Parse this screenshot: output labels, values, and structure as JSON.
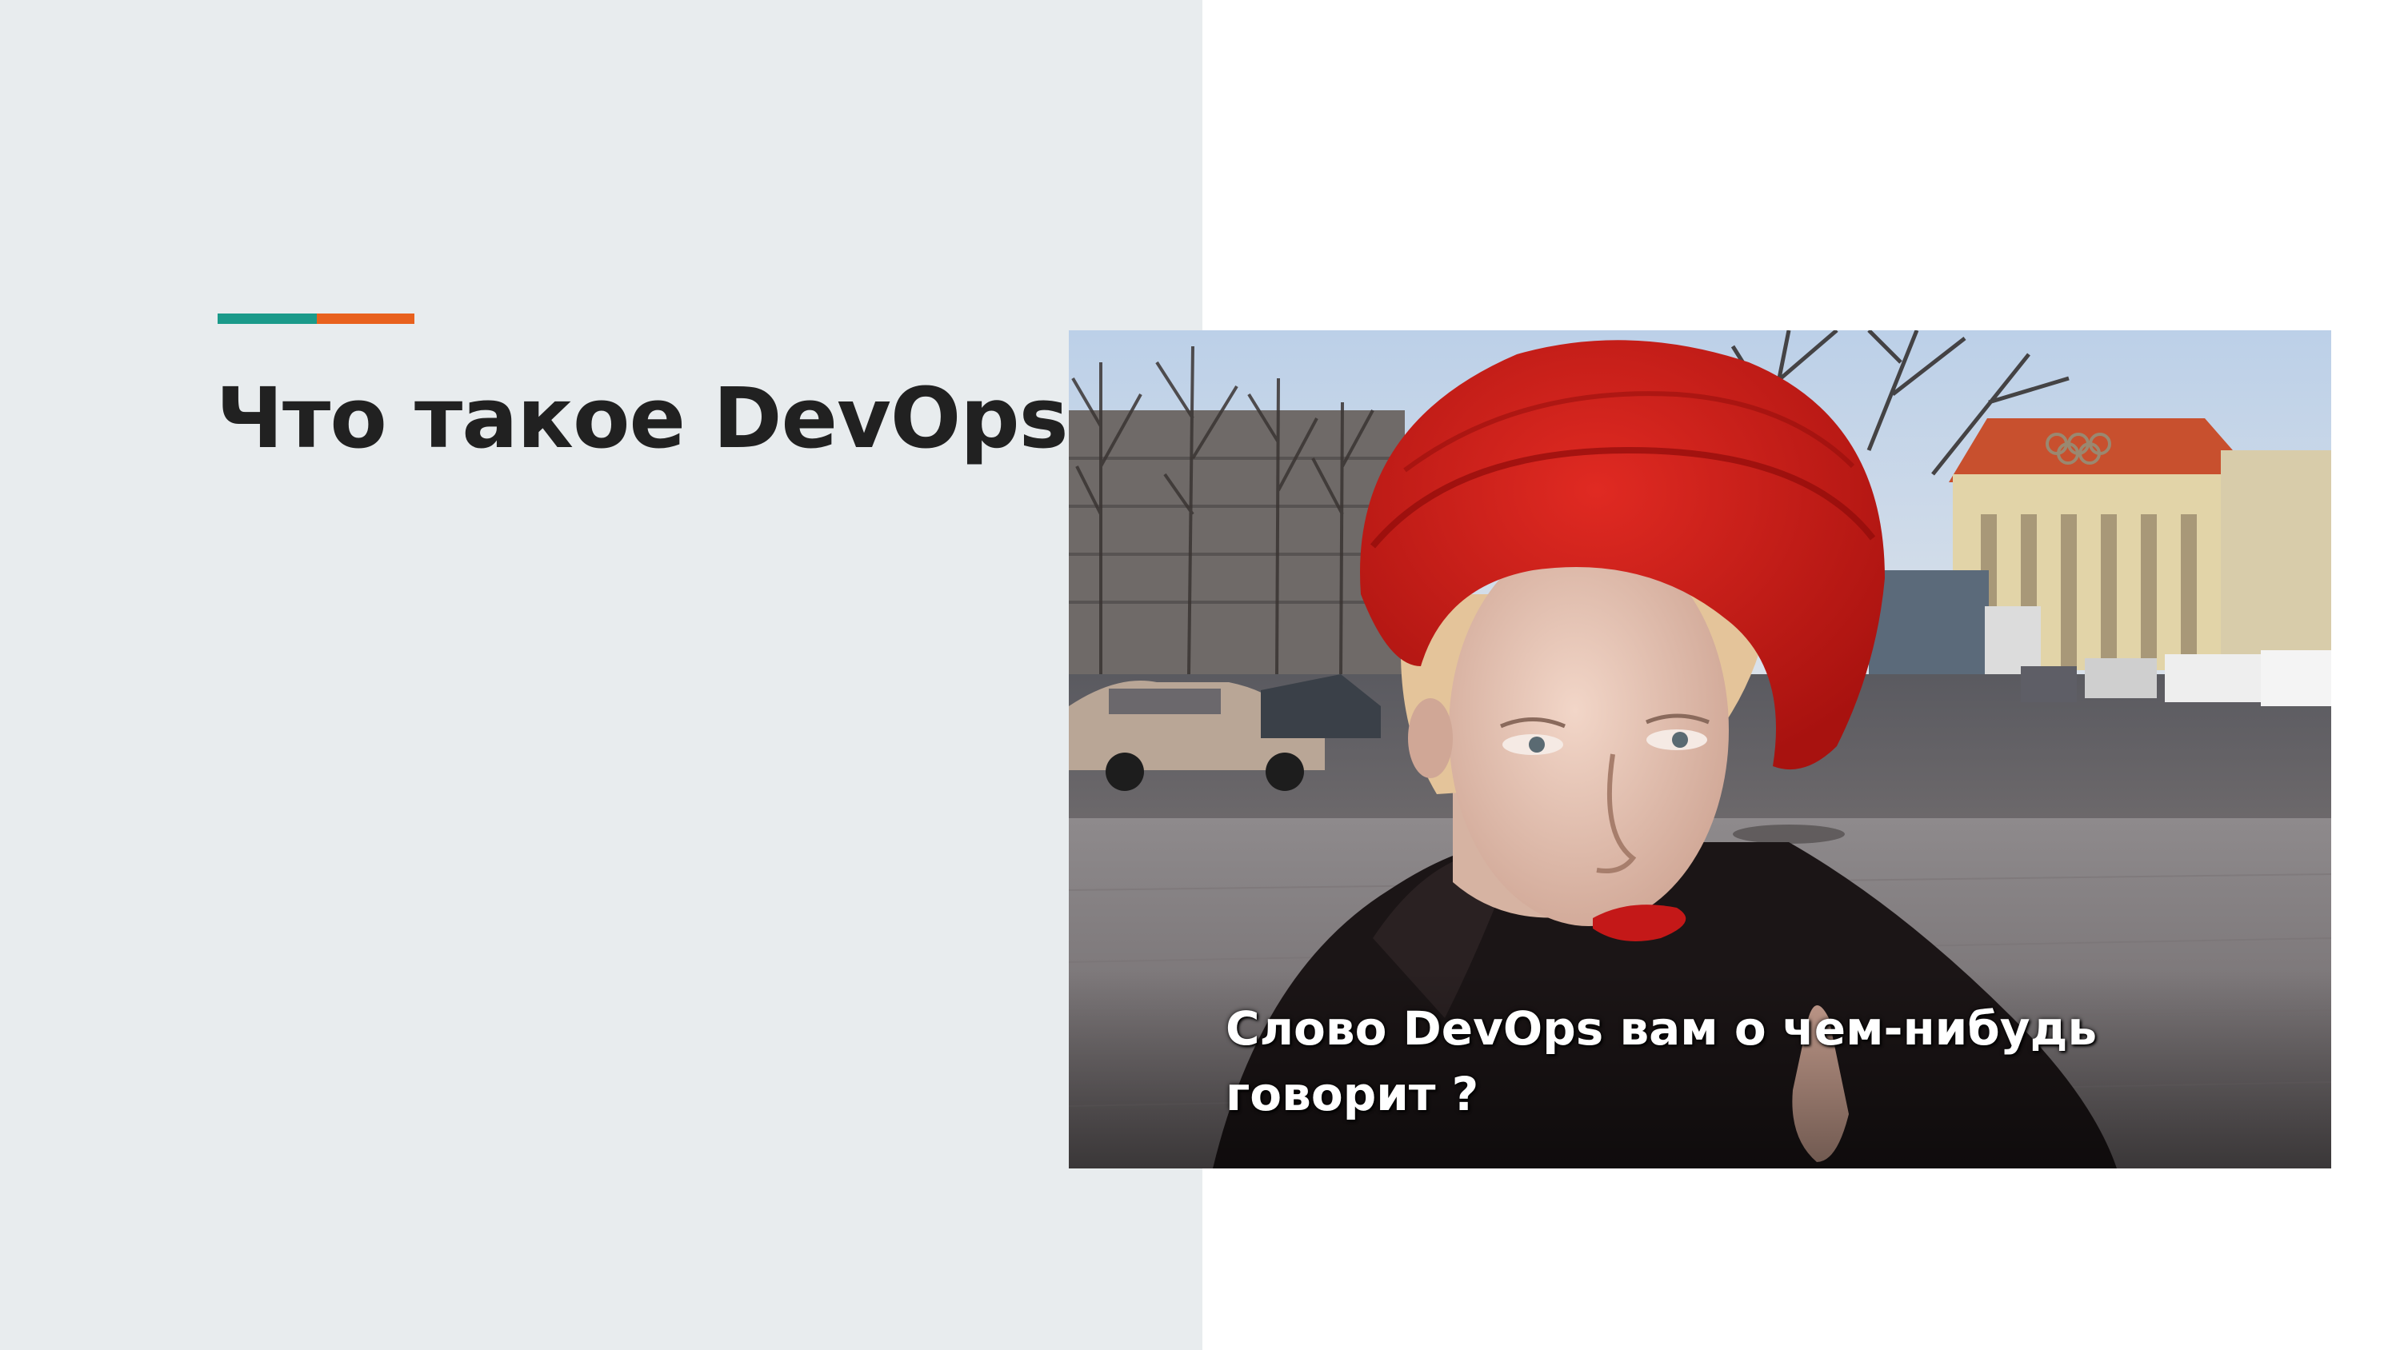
{
  "slide": {
    "title": "Что такое DevOps",
    "caption": "Слово DevOps вам о чем-нибудь говорит ?"
  },
  "colors": {
    "left_background": "#e8ecee",
    "right_background": "#ffffff",
    "accent_teal": "#1a9a8a",
    "accent_orange": "#e8611e",
    "title_text": "#212121",
    "hat_red": "#c81a1a"
  },
  "photo": {
    "subject": "street-interview-woman-red-hat"
  }
}
